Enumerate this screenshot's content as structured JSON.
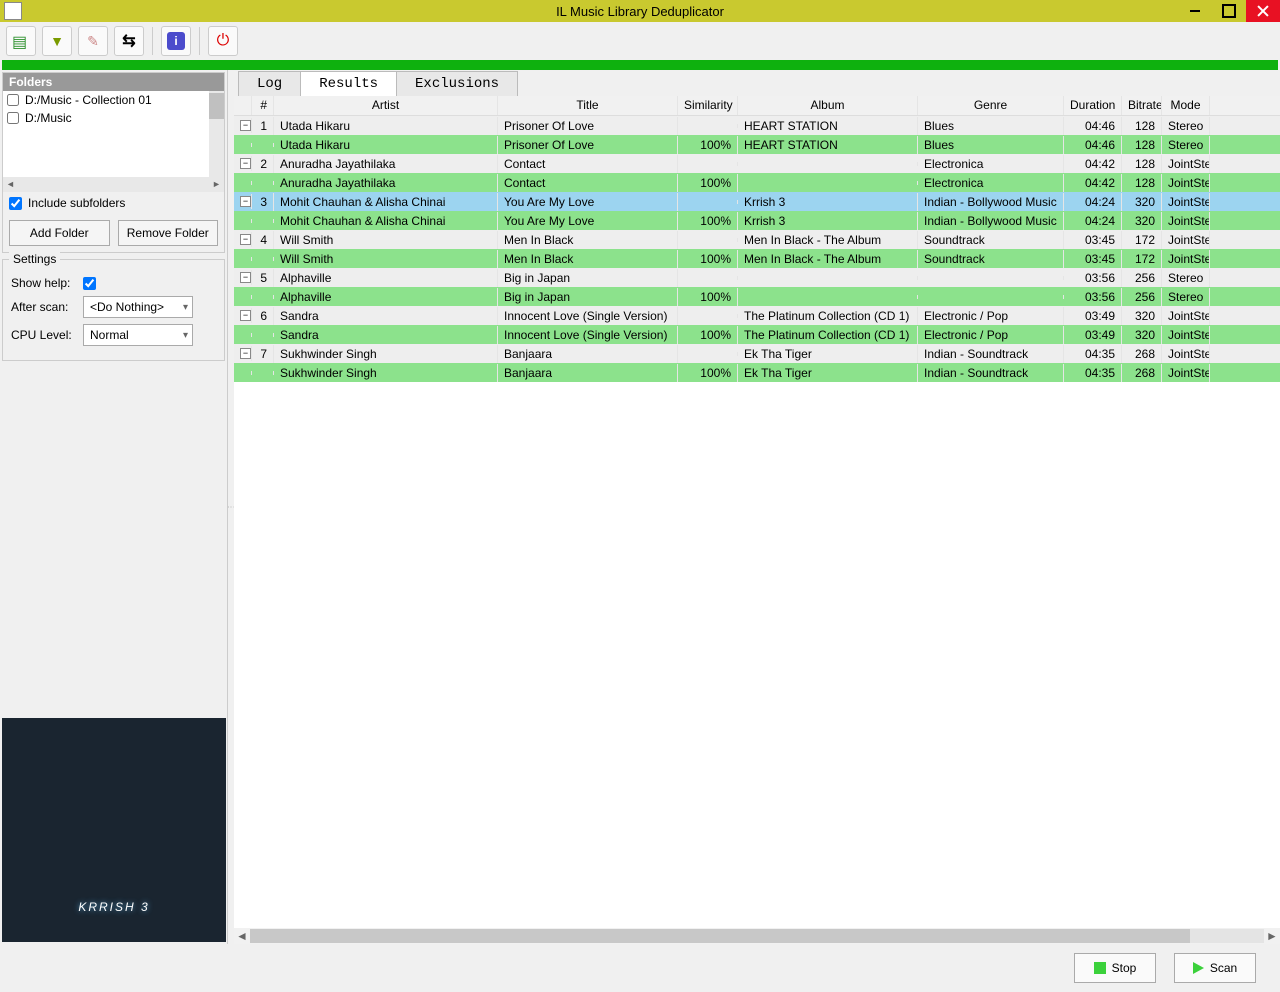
{
  "window": {
    "title": "IL Music Library Deduplicator"
  },
  "folders": {
    "header": "Folders",
    "items": [
      {
        "path": "D:/Music - Collection 01",
        "checked": false
      },
      {
        "path": "D:/Music",
        "checked": false
      }
    ],
    "include_subfolders_label": "Include subfolders",
    "include_subfolders_checked": true,
    "add_btn": "Add Folder",
    "remove_btn": "Remove Folder"
  },
  "settings": {
    "legend": "Settings",
    "show_help_label": "Show help:",
    "show_help_checked": true,
    "after_scan_label": "After scan:",
    "after_scan_value": "<Do Nothing>",
    "cpu_level_label": "CPU Level:",
    "cpu_level_value": "Normal"
  },
  "tabs": {
    "log": "Log",
    "results": "Results",
    "exclusions": "Exclusions",
    "active": "results"
  },
  "columns": {
    "num": "#",
    "artist": "Artist",
    "title": "Title",
    "similarity": "Similarity",
    "album": "Album",
    "genre": "Genre",
    "duration": "Duration",
    "bitrate": "Bitrate",
    "mode": "Mode"
  },
  "groups": [
    {
      "num": 1,
      "selected": false,
      "parent": {
        "artist": "Utada Hikaru",
        "title": "Prisoner Of Love",
        "sim": "",
        "album": "HEART STATION",
        "genre": "Blues",
        "dur": "04:46",
        "bitrate": "128",
        "mode": "Stereo"
      },
      "dup": {
        "artist": "Utada Hikaru",
        "title": "Prisoner Of Love",
        "sim": "100%",
        "album": "HEART STATION",
        "genre": "Blues",
        "dur": "04:46",
        "bitrate": "128",
        "mode": "Stereo"
      }
    },
    {
      "num": 2,
      "selected": false,
      "parent": {
        "artist": "Anuradha Jayathilaka",
        "title": "Contact",
        "sim": "",
        "album": "",
        "genre": "Electronica",
        "dur": "04:42",
        "bitrate": "128",
        "mode": "JointStereo"
      },
      "dup": {
        "artist": "Anuradha Jayathilaka",
        "title": "Contact",
        "sim": "100%",
        "album": "",
        "genre": "Electronica",
        "dur": "04:42",
        "bitrate": "128",
        "mode": "JointStereo"
      }
    },
    {
      "num": 3,
      "selected": true,
      "parent": {
        "artist": "Mohit Chauhan & Alisha Chinai",
        "title": "You Are My Love",
        "sim": "",
        "album": "Krrish 3",
        "genre": "Indian - Bollywood Music",
        "dur": "04:24",
        "bitrate": "320",
        "mode": "JointStereo"
      },
      "dup": {
        "artist": "Mohit Chauhan & Alisha Chinai",
        "title": "You Are My Love",
        "sim": "100%",
        "album": "Krrish 3",
        "genre": "Indian - Bollywood Music",
        "dur": "04:24",
        "bitrate": "320",
        "mode": "JointStereo"
      }
    },
    {
      "num": 4,
      "selected": false,
      "parent": {
        "artist": "Will Smith",
        "title": "Men In Black",
        "sim": "",
        "album": "Men In Black - The Album",
        "genre": "Soundtrack",
        "dur": "03:45",
        "bitrate": "172",
        "mode": "JointStereo"
      },
      "dup": {
        "artist": "Will Smith",
        "title": "Men In Black",
        "sim": "100%",
        "album": "Men In Black - The Album",
        "genre": "Soundtrack",
        "dur": "03:45",
        "bitrate": "172",
        "mode": "JointStereo"
      }
    },
    {
      "num": 5,
      "selected": false,
      "parent": {
        "artist": "Alphaville",
        "title": "Big in Japan",
        "sim": "",
        "album": "",
        "genre": "",
        "dur": "03:56",
        "bitrate": "256",
        "mode": "Stereo"
      },
      "dup": {
        "artist": "Alphaville",
        "title": "Big in Japan",
        "sim": "100%",
        "album": "",
        "genre": "",
        "dur": "03:56",
        "bitrate": "256",
        "mode": "Stereo"
      }
    },
    {
      "num": 6,
      "selected": false,
      "parent": {
        "artist": "Sandra",
        "title": "Innocent Love (Single Version)",
        "sim": "",
        "album": "The Platinum Collection (CD 1)",
        "genre": "Electronic / Pop",
        "dur": "03:49",
        "bitrate": "320",
        "mode": "JointStereo"
      },
      "dup": {
        "artist": "Sandra",
        "title": "Innocent Love (Single Version)",
        "sim": "100%",
        "album": "The Platinum Collection (CD 1)",
        "genre": "Electronic / Pop",
        "dur": "03:49",
        "bitrate": "320",
        "mode": "JointStereo"
      }
    },
    {
      "num": 7,
      "selected": false,
      "parent": {
        "artist": "Sukhwinder Singh",
        "title": "Banjaara",
        "sim": "",
        "album": "Ek Tha Tiger",
        "genre": "Indian - Soundtrack",
        "dur": "04:35",
        "bitrate": "268",
        "mode": "JointStereo"
      },
      "dup": {
        "artist": "Sukhwinder Singh",
        "title": "Banjaara",
        "sim": "100%",
        "album": "Ek Tha Tiger",
        "genre": "Indian - Soundtrack",
        "dur": "04:35",
        "bitrate": "268",
        "mode": "JointStereo"
      }
    }
  ],
  "album_art_title": "KRRISH 3",
  "footer": {
    "stop": "Stop",
    "scan": "Scan"
  }
}
